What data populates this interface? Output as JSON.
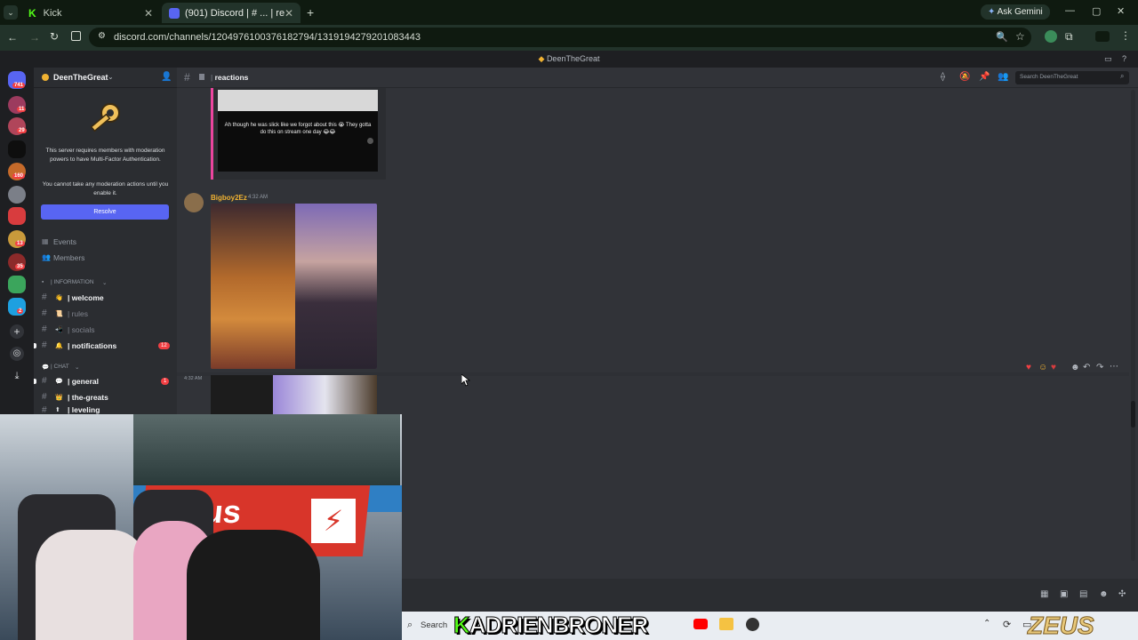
{
  "browser": {
    "tabs": [
      {
        "label": "Kick"
      },
      {
        "label": "(901) Discord | # ... | reactions"
      }
    ],
    "url": "discord.com/channels/1204976100376182794/1319194279201083443",
    "ask_gemini": "Ask Gemini"
  },
  "discord": {
    "window_title": "DeenTheGreat",
    "server_name": "DeenTheGreat",
    "mfa": {
      "line1": "This server requires members with moderation powers to have Multi-Factor Authentication.",
      "line2": "You cannot take any moderation actions until you enable it.",
      "resolve": "Resolve"
    },
    "nav": {
      "events": "Events",
      "members": "Members"
    },
    "categories": {
      "information": "| INFORMATION",
      "chat": "| CHAT"
    },
    "channels": [
      {
        "label": "| welcome",
        "emoji": "👋"
      },
      {
        "label": "| rules",
        "emoji": "📜"
      },
      {
        "label": "| socials",
        "emoji": "📲"
      },
      {
        "label": "| notifications",
        "emoji": "🔔",
        "badge": "12"
      },
      {
        "label": "| general",
        "emoji": "💬",
        "badge": "1"
      },
      {
        "label": "| the-greats",
        "emoji": "👑"
      },
      {
        "label": "| leveling",
        "emoji": "⬆"
      }
    ],
    "channel_header": {
      "name": "reactions",
      "search_placeholder": "Search DeenTheGreat"
    },
    "messages": [
      {
        "caption": "Ah though he was slick like we forgot about this 😭 They gotta do this on stream one day 😂😂"
      },
      {
        "author": "Bigboy2Ez",
        "time": "4:32 AM"
      },
      {
        "time": "4:32 AM"
      }
    ],
    "server_badges": [
      "741",
      "11",
      "29",
      "160",
      "13",
      "35",
      "2"
    ]
  },
  "taskbar": {
    "search": "Search",
    "overlay_text": "ADRIENBRONER",
    "zeus": "ZEUS"
  },
  "colors": {
    "blurple": "#5865f2",
    "mention_red": "#f23f43",
    "author_gold": "#f0b232"
  }
}
